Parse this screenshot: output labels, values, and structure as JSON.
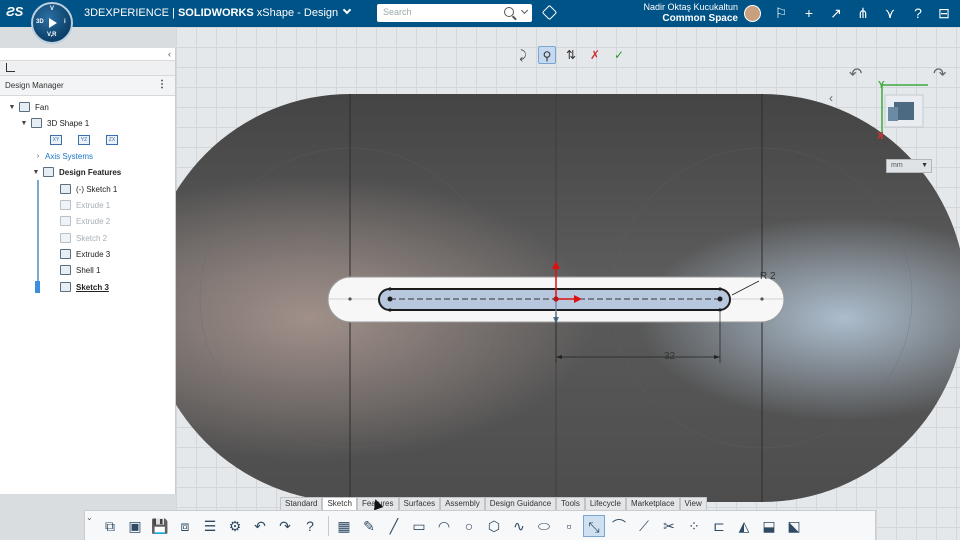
{
  "topbar": {
    "brand_prefix": "3DEXPERIENCE",
    "brand_sep": " | ",
    "brand_app": "SOLIDWORKS",
    "brand_suffix": " xShape - Design",
    "search_placeholder": "Search",
    "user_name": "Nadir Oktaş Kucukaltun",
    "space": "Common Space",
    "compass": {
      "top": "V",
      "left": "3D",
      "right": "i",
      "bottom": "V,R"
    }
  },
  "panel": {
    "title": "Design Manager",
    "tree": [
      {
        "label": "Fan",
        "icon": "assembly-icon"
      },
      {
        "label": "3D Shape 1",
        "icon": "shape-icon"
      },
      {
        "label": "Axis Systems",
        "icon": "axis-icon"
      },
      {
        "label": "Design Features",
        "icon": "features-icon"
      },
      {
        "label": "(-) Sketch 1",
        "icon": "sketch-icon"
      },
      {
        "label": "Extrude 1",
        "icon": "extrude-icon"
      },
      {
        "label": "Extrude 2",
        "icon": "extrude-icon"
      },
      {
        "label": "Sketch 2",
        "icon": "sketch-icon"
      },
      {
        "label": "Extrude 3",
        "icon": "extrude-icon"
      },
      {
        "label": "Shell 1",
        "icon": "shell-icon"
      },
      {
        "label": "Sketch 3",
        "icon": "sketch-icon"
      }
    ],
    "axis_planes": [
      "XY",
      "YZ",
      "ZX"
    ]
  },
  "viewport": {
    "dimension_radius": "R 2",
    "dimension_length": "32",
    "units": "mm",
    "triad": {
      "y": "Y",
      "x": "X"
    }
  },
  "bottom_tabs": [
    "Standard",
    "Sketch",
    "Features",
    "Surfaces",
    "Assembly",
    "Design Guidance",
    "Tools",
    "Lifecycle",
    "Marketplace",
    "View"
  ],
  "active_tab": "Sketch",
  "colors": {
    "topbar": "#005386",
    "accent": "#1a73c8",
    "slot_fill": "#b7c7dd"
  }
}
